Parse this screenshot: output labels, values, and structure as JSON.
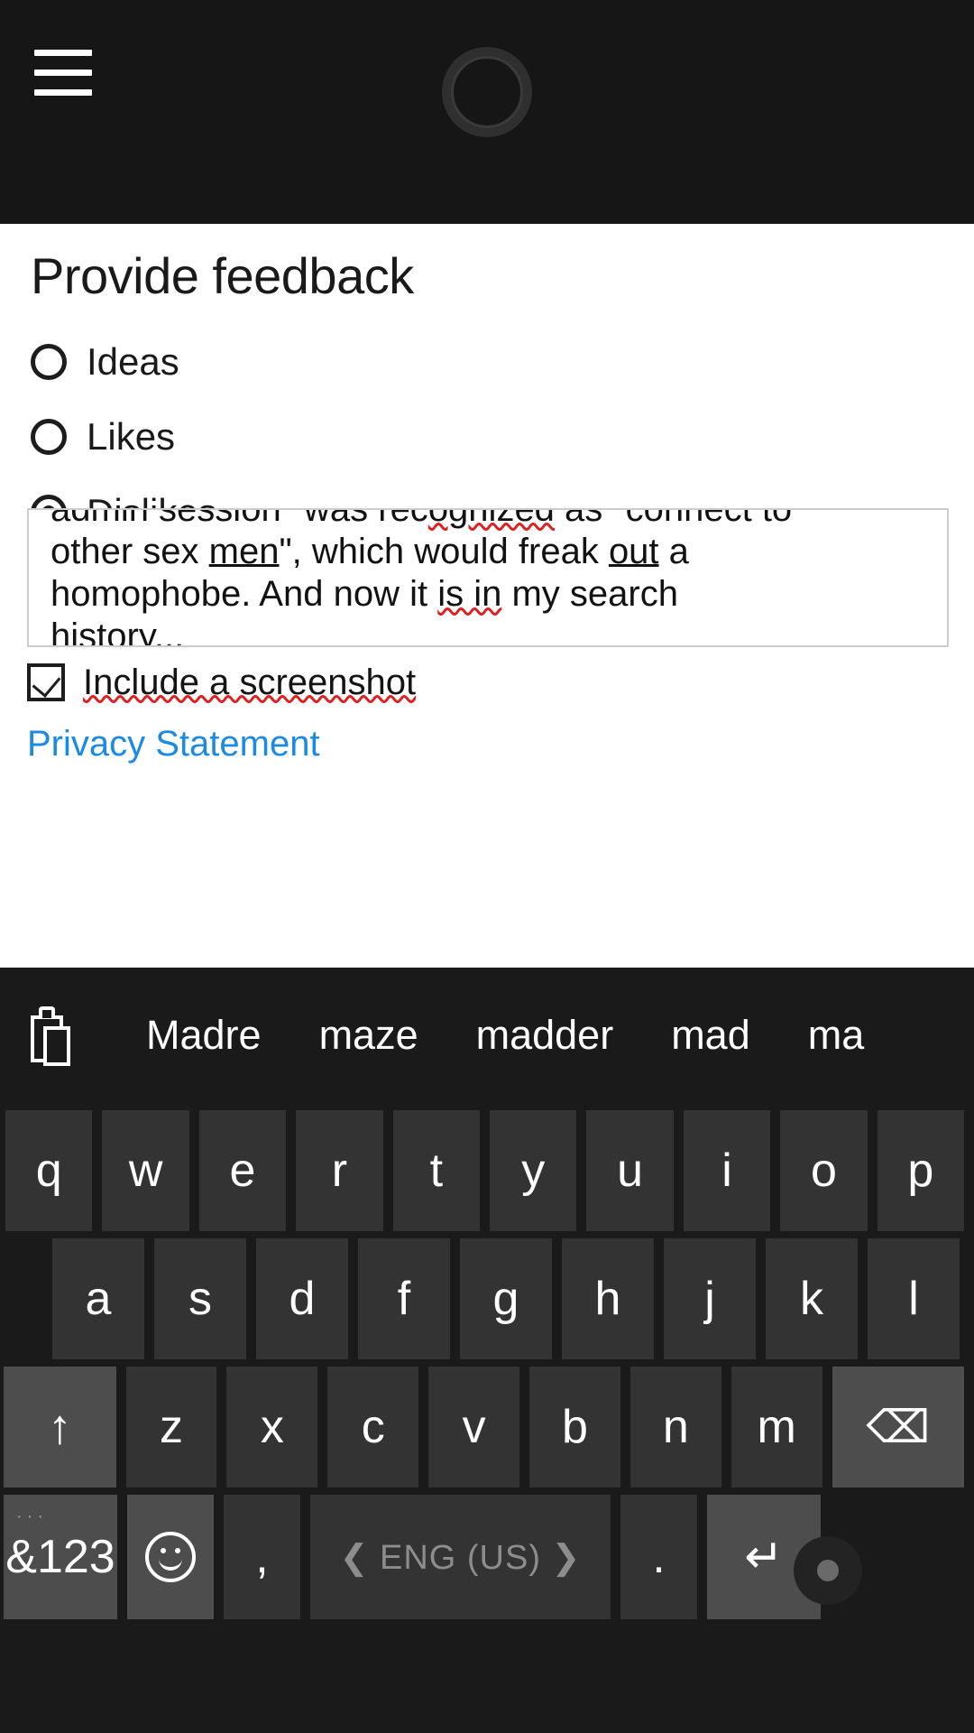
{
  "header": {
    "menu_icon": "hamburger-menu-icon",
    "logo_icon": "cortana-ring-icon"
  },
  "feedback": {
    "title": "Provide feedback",
    "options": [
      {
        "label": "Ideas",
        "selected": false
      },
      {
        "label": "Likes",
        "selected": false
      },
      {
        "label": "Dislikes",
        "selected": true
      }
    ],
    "textarea": {
      "line1": "admin session\" was rec",
      "line1_misspelled": "ognized",
      "line1_tail": " as \"connect to",
      "line2_a": "other sex ",
      "line2_underline1": "men",
      "line2_b": "\", which would freak ",
      "line2_underline2": "out",
      "line2_c": " a",
      "line3_a": "homophobe. And now it ",
      "line3_misspelled": "is in",
      "line3_b": " my search",
      "line4_misspelled": "history...",
      "full_value": "admin session\" was recognized as \"connect to other sex men\", which would freak out a homophobe. And now it is in my search history..."
    },
    "screenshot_checkbox": {
      "label": "Include a screenshot",
      "checked": true
    },
    "privacy_link": "Privacy Statement"
  },
  "keyboard": {
    "clipboard_icon": "clipboard-icon",
    "suggestions": [
      "Madre",
      "maze",
      "madder",
      "mad",
      "ma"
    ],
    "row1": [
      "q",
      "w",
      "e",
      "r",
      "t",
      "y",
      "u",
      "i",
      "o",
      "p"
    ],
    "row2": [
      "a",
      "s",
      "d",
      "f",
      "g",
      "h",
      "j",
      "k",
      "l"
    ],
    "row3_shift": "↑",
    "row3": [
      "z",
      "x",
      "c",
      "v",
      "b",
      "n",
      "m"
    ],
    "row3_backspace": "⌫",
    "row4": {
      "symbols": "&123",
      "symbols_dots": "···",
      "emoji": "emoji-smiley-icon",
      "comma": ",",
      "space_label": "❮  ENG (US)  ❯",
      "period": ".",
      "enter": "↵"
    }
  },
  "colors": {
    "header_bg": "#161616",
    "panel_bg": "#ffffff",
    "keyboard_bg": "#1a1a1a",
    "key_bg": "#333333",
    "key_light_bg": "#4d4d4d",
    "link": "#1a8ae5",
    "spellcheck": "#e02020"
  }
}
